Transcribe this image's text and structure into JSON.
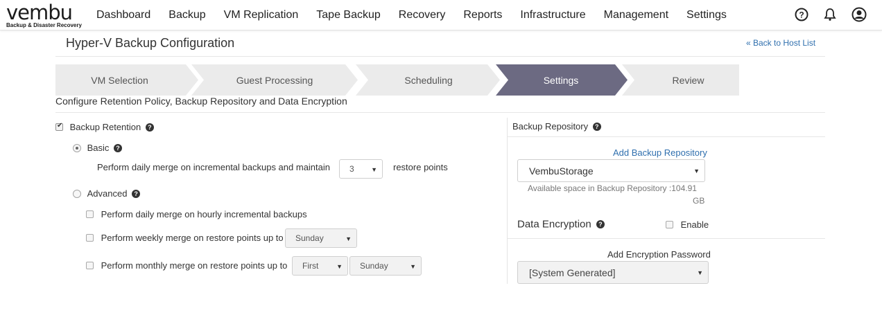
{
  "logo": {
    "word": "vembu",
    "tagline": "Backup & Disaster Recovery"
  },
  "nav": [
    "Dashboard",
    "Backup",
    "VM Replication",
    "Tape Backup",
    "Recovery",
    "Reports",
    "Infrastructure",
    "Management",
    "Settings"
  ],
  "top_icons": [
    "help-icon",
    "bell-icon",
    "user-icon"
  ],
  "page": {
    "title": "Hyper-V Backup Configuration",
    "back_link": "« Back to Host List",
    "description": "Configure Retention Policy, Backup Repository and Data Encryption"
  },
  "wizard": {
    "steps": [
      "VM Selection",
      "Guest Processing",
      "Scheduling",
      "Settings",
      "Review"
    ],
    "active": "Settings",
    "colors": {
      "inactive": "#ebebeb",
      "active": "#6c6a82"
    }
  },
  "retention": {
    "label": "Backup Retention",
    "checked": true,
    "basic": {
      "label": "Basic",
      "selected": true,
      "text_before": "Perform daily merge on incremental backups and maintain",
      "value": "3",
      "text_after": "restore points"
    },
    "advanced": {
      "label": "Advanced",
      "selected": false,
      "daily_label": "Perform daily merge on hourly incremental backups",
      "weekly_label": "Perform weekly merge on restore points up to",
      "weekly_day": "Sunday",
      "monthly_label": "Perform monthly merge on restore points up to",
      "monthly_week": "First",
      "monthly_day": "Sunday"
    }
  },
  "repository": {
    "heading": "Backup Repository",
    "add_link": "Add Backup Repository",
    "selected": "VembuStorage",
    "space_line1": "Available space in Backup Repository :104.91",
    "space_line2": "GB"
  },
  "encryption": {
    "heading": "Data Encryption",
    "enable_label": "Enable",
    "enabled": false,
    "password_label": "Add Encryption Password",
    "password_value": "[System Generated]"
  }
}
